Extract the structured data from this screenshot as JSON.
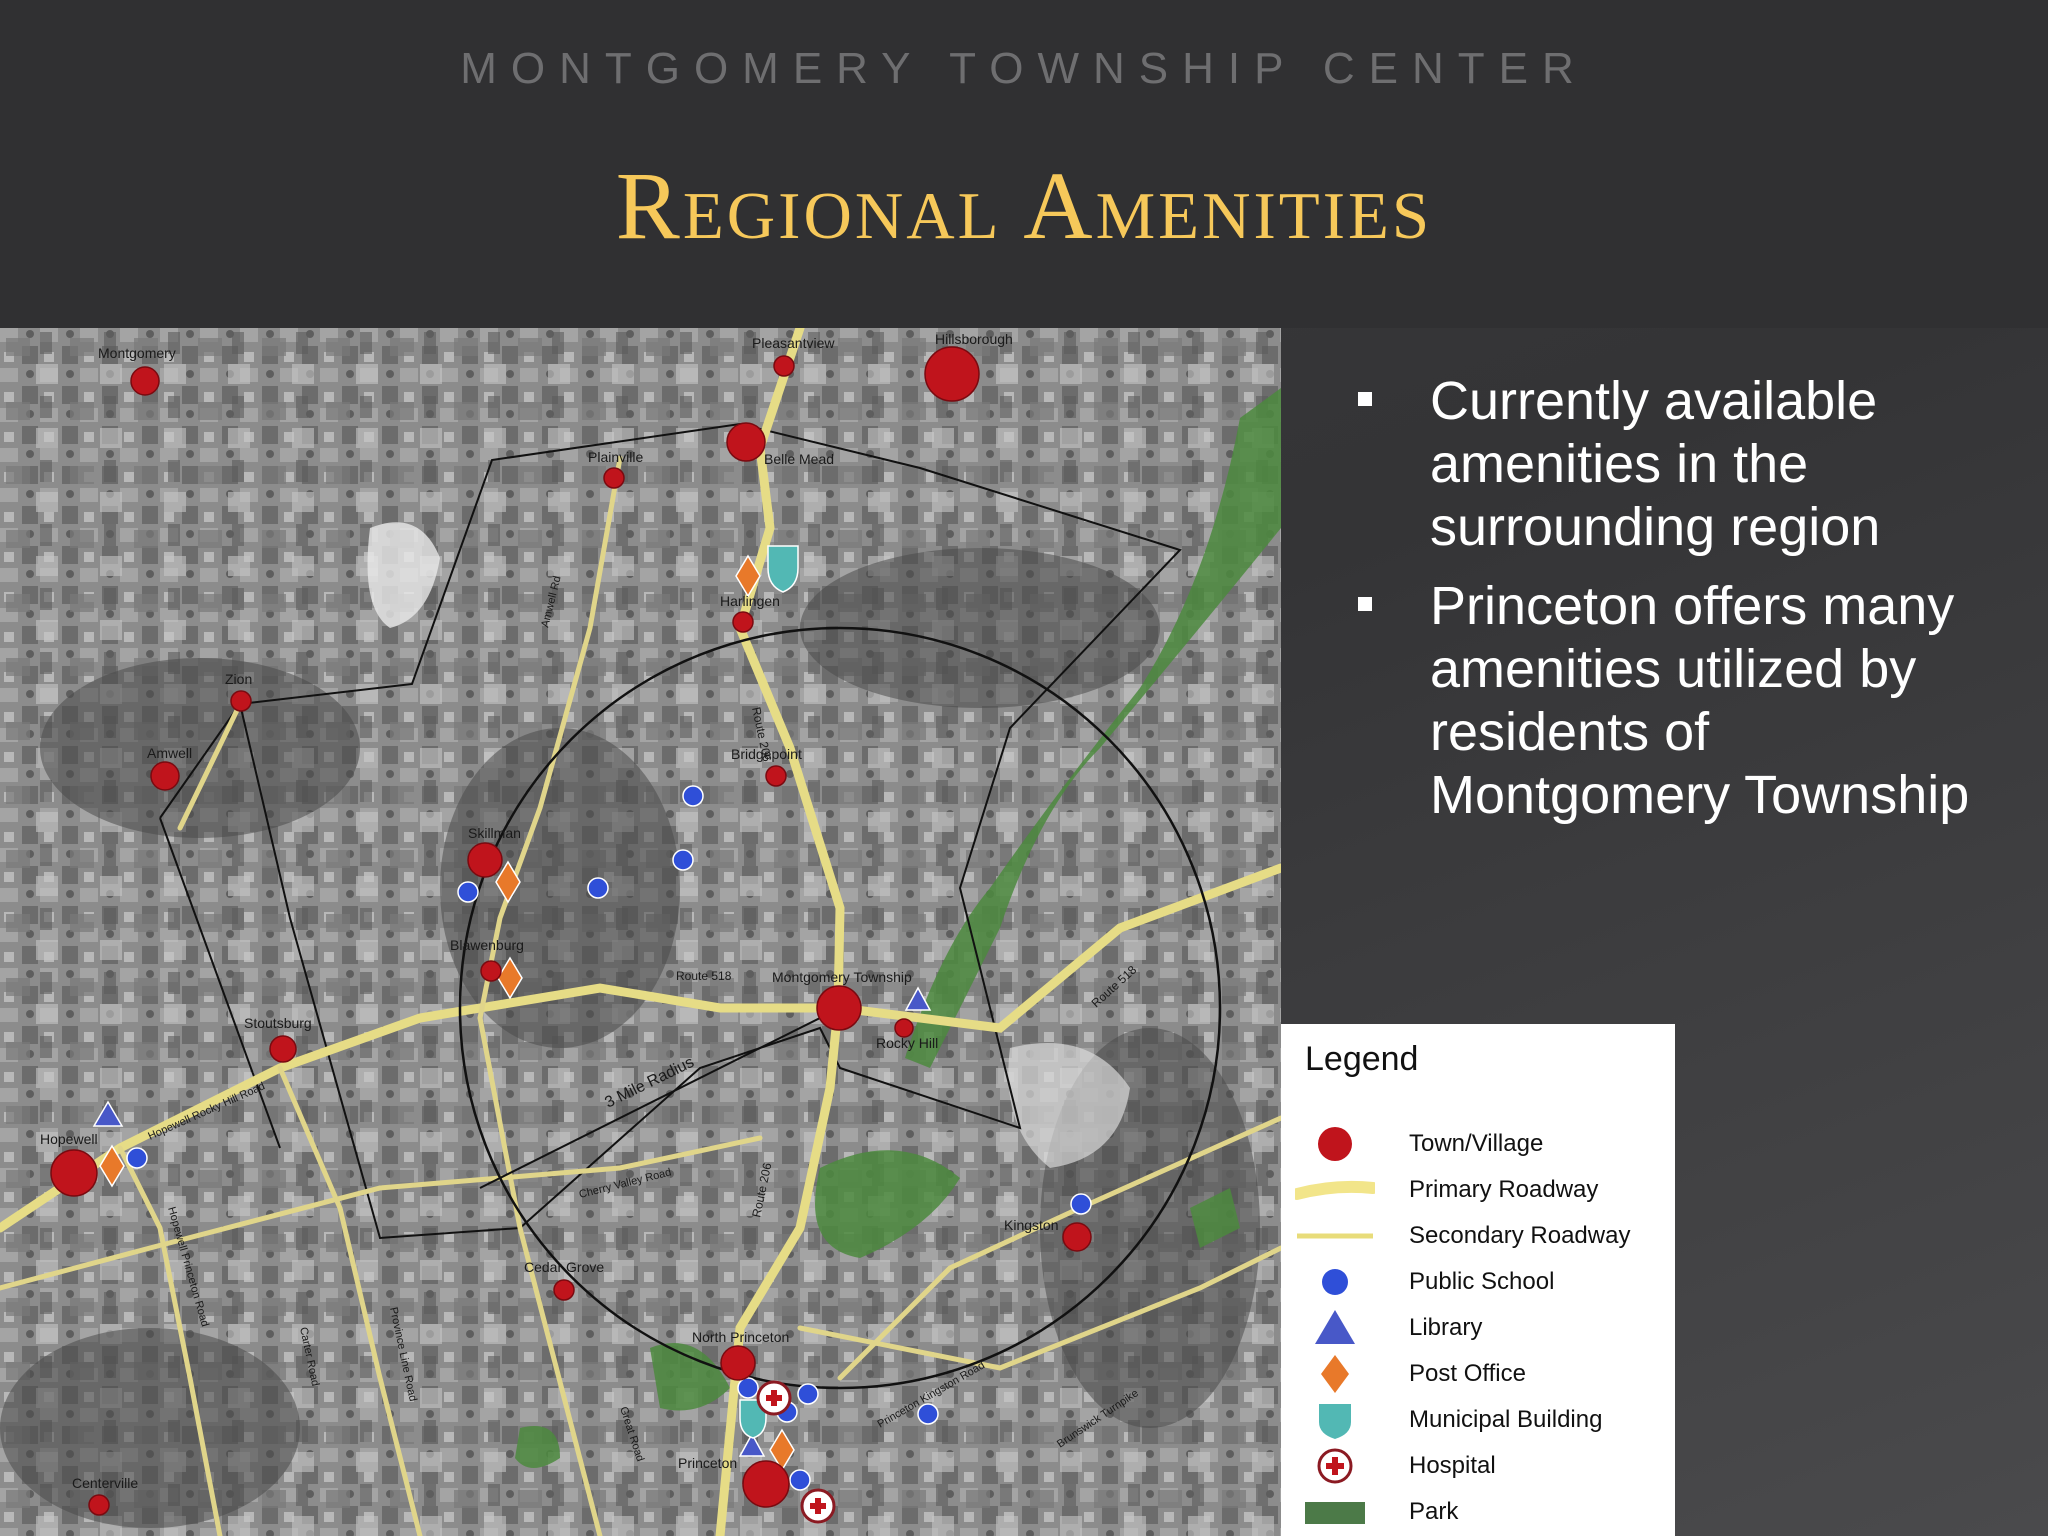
{
  "header": {
    "subtitle": "MONTGOMERY TOWNSHIP CENTER",
    "title": "Regional Amenities"
  },
  "bullets": [
    "Currently available amenities in the surrounding region",
    "Princeton offers many amenities utilized by residents of Montgomery Township"
  ],
  "map": {
    "places": {
      "montgomery": "Montgomery",
      "pleasantview": "Pleasantview",
      "hillsborough": "Hillsborough",
      "plainville": "Plainville",
      "belle_mead": "Belle Mead",
      "harlingen": "Harlingen",
      "zion": "Zion",
      "amwell": "Amwell",
      "bridgepoint": "Bridgepoint",
      "skillman": "Skillman",
      "blawenburg": "Blawenburg",
      "montgomery_township": "Montgomery Township",
      "rocky_hill": "Rocky Hill",
      "stoutsburg": "Stoutsburg",
      "hopewell": "Hopewell",
      "kingston": "Kingston",
      "cedar_grove": "Cedar Grove",
      "north_princeton": "North Princeton",
      "princeton": "Princeton",
      "centerville": "Centerville"
    },
    "roads": {
      "route_518_west": "Route 518",
      "route_518_east": "Route 518",
      "route_206_north": "Route 206",
      "route_206_south": "Route 206",
      "hopewell_rocky_hill_road": "Hopewell Rocky Hill Road",
      "cherry_valley_road": "Cherry Valley Road",
      "amwell_road": "Amwell Rd",
      "great_road": "Great Road",
      "princeton_kingston_road": "Princeton Kingston Road",
      "province_line_road": "Province Line Road",
      "carter_road": "Carter Road",
      "hopewell_princeton_road": "Hopewell Princeton Road",
      "brunswick_pike": "Brunswick Turnpike"
    },
    "radius_label": "3 Mile Radius"
  },
  "legend": {
    "title": "Legend",
    "items": [
      {
        "label": "Town/Village",
        "icon": "town-village-icon",
        "color": "#c0141c"
      },
      {
        "label": "Primary Roadway",
        "icon": "primary-roadway-icon",
        "color": "#f2e58a"
      },
      {
        "label": "Secondary Roadway",
        "icon": "secondary-roadway-icon",
        "color": "#e8dc7a"
      },
      {
        "label": "Public School",
        "icon": "public-school-icon",
        "color": "#2f4fd8"
      },
      {
        "label": "Library",
        "icon": "library-icon",
        "color": "#4858c8"
      },
      {
        "label": "Post Office",
        "icon": "post-office-icon",
        "color": "#e8792a"
      },
      {
        "label": "Municipal Building",
        "icon": "municipal-building-icon",
        "color": "#52b8b4"
      },
      {
        "label": "Hospital",
        "icon": "hospital-icon",
        "color": "#b8222a"
      },
      {
        "label": "Park",
        "icon": "park-icon",
        "color": "#4c7a48"
      }
    ]
  }
}
